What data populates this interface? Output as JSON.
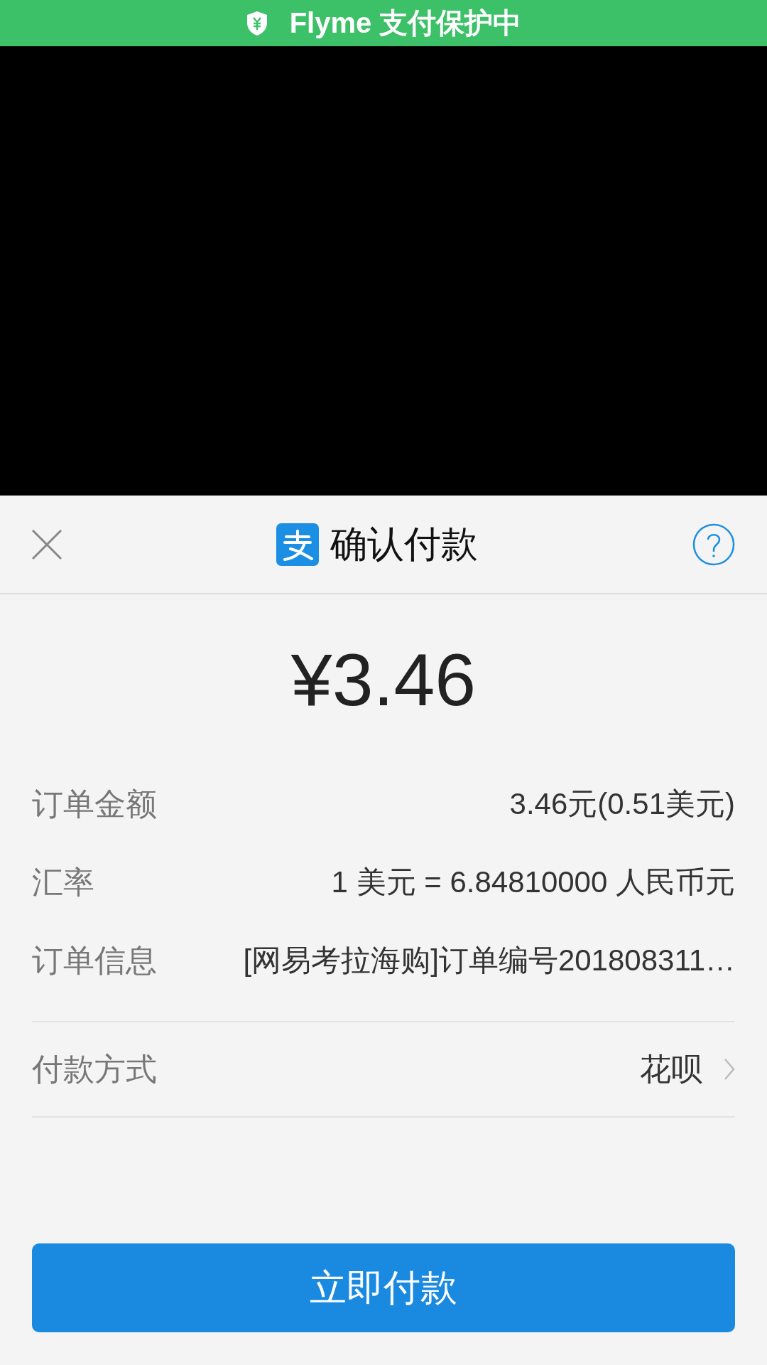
{
  "protection_banner": {
    "text": "Flyme 支付保护中"
  },
  "header": {
    "title": "确认付款"
  },
  "amount": "¥3.46",
  "details": [
    {
      "label": "订单金额",
      "value": "3.46元(0.51美元)"
    },
    {
      "label": "汇率",
      "value": "1 美元 = 6.84810000 人民币元"
    },
    {
      "label": "订单信息",
      "value": "[网易考拉海购]订单编号201808311…"
    }
  ],
  "payment_method": {
    "label": "付款方式",
    "value": "花呗"
  },
  "pay_button": "立即付款"
}
